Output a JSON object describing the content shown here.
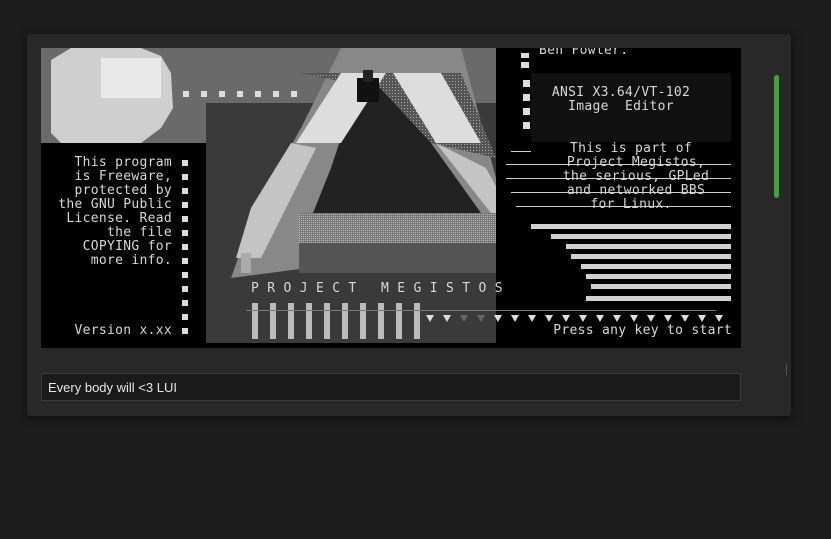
{
  "terminal": {
    "author": "Ben Fowler.",
    "editor_line1": "ANSI X3.64/VT-102",
    "editor_line2": "Image  Editor",
    "freeware_lines": [
      "This program",
      "is Freeware,",
      "protected by",
      "the GNU Public",
      "License. Read",
      "the file",
      "COPYING for",
      "more info."
    ],
    "about_lines": [
      "This is part of",
      "Project Megistos,",
      "the serious, GPLed",
      "and networked BBS",
      "for Linux."
    ],
    "project_title": "P R O J E C T   M E G I S T O S",
    "version": "Version x.xx",
    "press_key": "Press any key to start"
  },
  "chat_input": {
    "value": "Every body will <3 LUI"
  },
  "colors": {
    "scrollbar": "#3fa535",
    "terminal_bg": "#000000",
    "window_bg": "#282828"
  }
}
